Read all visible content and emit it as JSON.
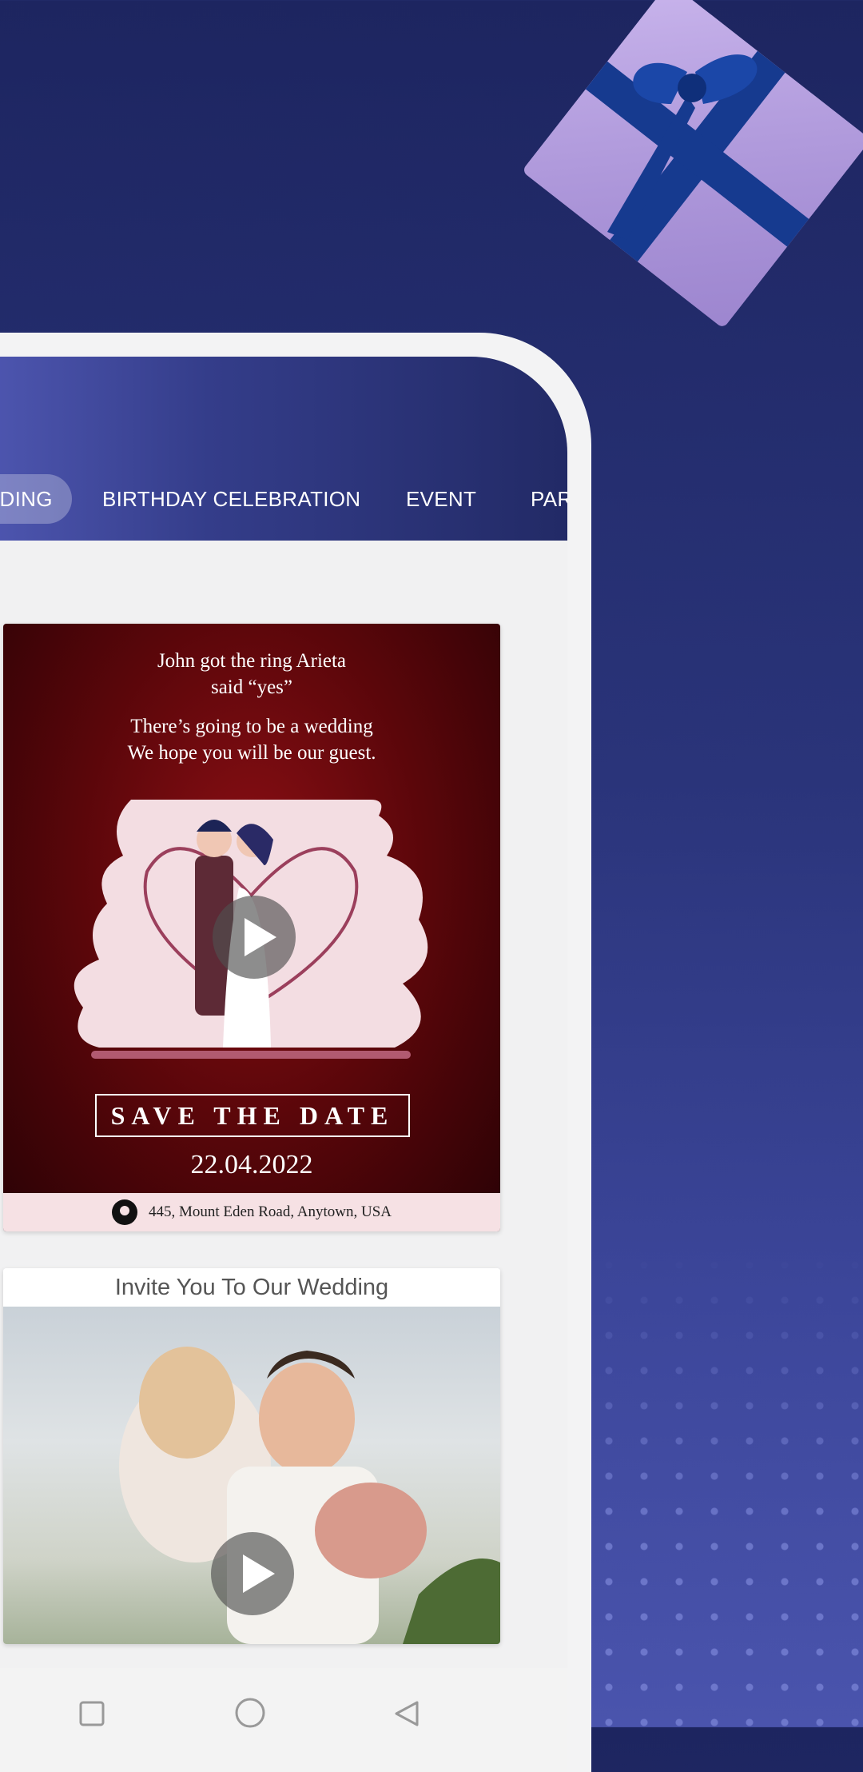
{
  "tabs": [
    {
      "label": "WEDDING",
      "active": true
    },
    {
      "label": "BIRTHDAY CELEBRATION",
      "active": false
    },
    {
      "label": "EVENT",
      "active": false
    },
    {
      "label": "PARTY",
      "active": false
    }
  ],
  "cards": [
    {
      "line1": "John got the ring Arieta\nsaid “yes”",
      "line2": "There’s going to be a wedding\nWe hope you will be our guest.",
      "save_the_date": "SAVE THE DATE",
      "date": "22.04.2022",
      "address": "445, Mount Eden Road, Anytown, USA"
    },
    {
      "title": "Invite You To Our Wedding"
    }
  ],
  "colors": {
    "background": "#2a347a",
    "appbar": "#343d8a",
    "card_red": "#5a060a"
  },
  "icons": {
    "play": "play-icon",
    "pin": "location-pin-icon",
    "nav_recent": "square-icon",
    "nav_home": "circle-icon",
    "nav_back": "triangle-back-icon"
  }
}
